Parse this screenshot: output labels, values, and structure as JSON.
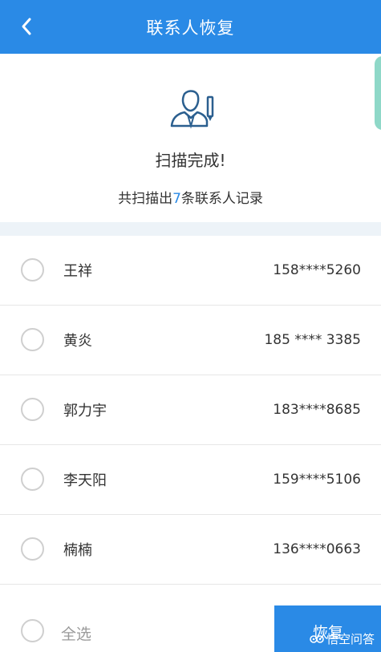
{
  "header": {
    "title": "联系人恢复",
    "back_icon": "chevron-left-icon",
    "color": "#2a8ae6"
  },
  "scan": {
    "icon": "contact-edit-icon",
    "status": "扫描完成!",
    "summary_prefix": "共扫描出",
    "summary_count": "7",
    "summary_suffix": "条联系人记录"
  },
  "contacts": [
    {
      "name": "王祥",
      "phone": "158****5260",
      "selected": false
    },
    {
      "name": "黄炎",
      "phone": "185 **** 3385",
      "selected": false
    },
    {
      "name": "郭力宇",
      "phone": "183****8685",
      "selected": false
    },
    {
      "name": "李天阳",
      "phone": "159****5106",
      "selected": false
    },
    {
      "name": "楠楠",
      "phone": "136****0663",
      "selected": false
    }
  ],
  "footer": {
    "select_all_label": "全选",
    "restore_label": "恢复"
  },
  "watermark": {
    "text": "悟空问答",
    "icon": "wukong-logo-icon"
  }
}
